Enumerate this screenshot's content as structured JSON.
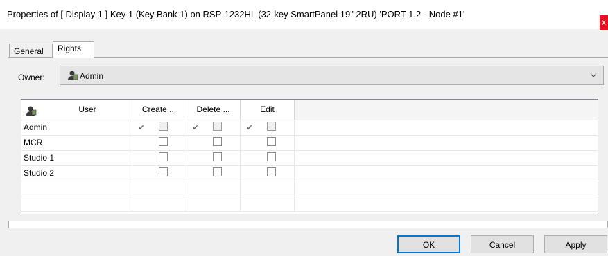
{
  "window": {
    "title": "Properties of [ Display 1 ] Key 1 (Key Bank 1) on RSP-1232HL (32-key SmartPanel 19\" 2RU) 'PORT 1.2 - Node #1'",
    "close_label": "x"
  },
  "tabs": [
    {
      "label": "General",
      "selected": false
    },
    {
      "label": "Rights",
      "selected": true
    }
  ],
  "owner": {
    "label": "Owner:",
    "value": "Admin",
    "icon": "user-icon"
  },
  "grid": {
    "columns": [
      {
        "label": "User",
        "icon": "user-icon"
      },
      {
        "label": "Create ..."
      },
      {
        "label": "Delete ..."
      },
      {
        "label": "Edit"
      }
    ],
    "rows": [
      {
        "user": "Admin",
        "inherited_checks": [
          "✔",
          "✔",
          "✔"
        ],
        "create": false,
        "delete": false,
        "edit": false,
        "dim": true
      },
      {
        "user": "MCR",
        "inherited_checks": [],
        "create": false,
        "delete": false,
        "edit": false,
        "dim": false
      },
      {
        "user": "Studio 1",
        "inherited_checks": [],
        "create": false,
        "delete": false,
        "edit": false,
        "dim": false
      },
      {
        "user": "Studio 2",
        "inherited_checks": [],
        "create": false,
        "delete": false,
        "edit": false,
        "dim": false
      }
    ]
  },
  "buttons": {
    "ok": "OK",
    "cancel": "Cancel",
    "apply": "Apply"
  },
  "colors": {
    "accent": "#0078d7",
    "close": "#e81123"
  }
}
